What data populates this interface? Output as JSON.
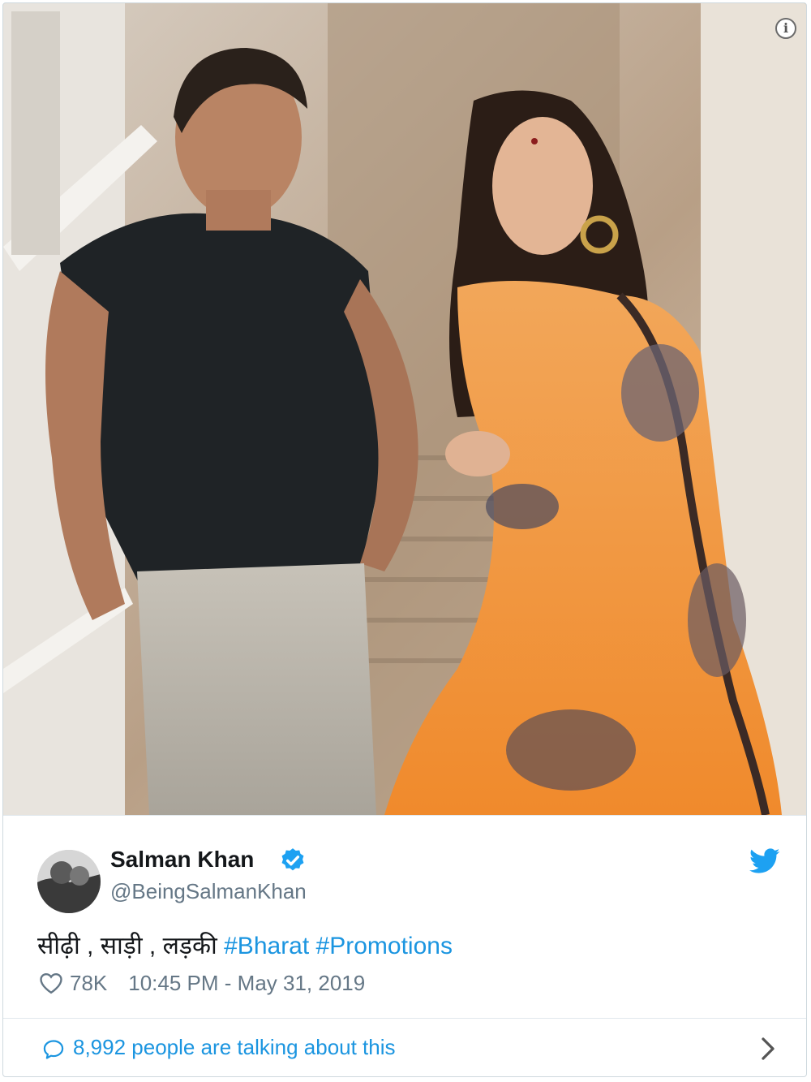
{
  "tweet": {
    "author_name": "Salman Khan",
    "author_handle": "@BeingSalmanKhan",
    "verified": true,
    "text_plain": "सीढ़ी , साड़ी , लड़की ",
    "hashtags": [
      "#Bharat",
      "#Promotions"
    ],
    "likes": "78K",
    "timestamp": "10:45 PM - May 31, 2019",
    "talking_text": "8,992 people are talking about this"
  },
  "icons": {
    "info": "info-icon",
    "info_glyph": "i",
    "verified": "verified-badge-icon",
    "brand": "twitter-bird-icon",
    "like": "heart-icon",
    "reply": "speech-bubble-icon",
    "more": "chevron-right-icon"
  },
  "colors": {
    "link": "#1b95e0",
    "text": "#14171a",
    "muted": "#657786",
    "border": "#e1e8ed"
  }
}
